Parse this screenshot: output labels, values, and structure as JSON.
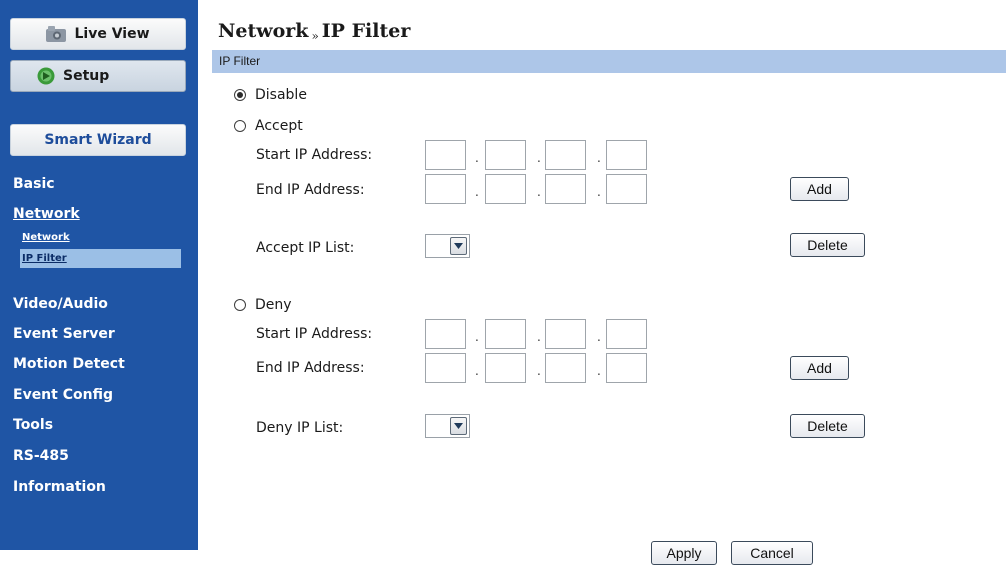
{
  "sidebar": {
    "live_view": "Live View",
    "setup": "Setup",
    "smart_wizard": "Smart Wizard",
    "menu": {
      "basic": "Basic",
      "network": "Network",
      "video_audio": "Video/Audio",
      "event_server": "Event Server",
      "motion_detect": "Motion Detect",
      "event_config": "Event Config",
      "tools": "Tools",
      "rs485": "RS-485",
      "information": "Information"
    },
    "submenu": {
      "network": "Network",
      "ip_filter": "IP Filter"
    }
  },
  "header": {
    "title_section": "Network",
    "title_separator": "»",
    "title_page": "IP Filter",
    "section_bar": "IP Filter"
  },
  "form": {
    "mode_options": [
      {
        "label": "Disable",
        "selected": true
      },
      {
        "label": "Accept",
        "selected": false
      },
      {
        "label": "Deny",
        "selected": false
      }
    ],
    "accept": {
      "start_label": "Start IP Address:",
      "end_label": "End IP Address:",
      "list_label": "Accept IP List:",
      "start_ip": [
        "",
        "",
        "",
        ""
      ],
      "end_ip": [
        "",
        "",
        "",
        ""
      ],
      "list_value": "",
      "add_label": "Add",
      "delete_label": "Delete"
    },
    "deny": {
      "start_label": "Start IP Address:",
      "end_label": "End IP Address:",
      "list_label": "Deny IP List:",
      "start_ip": [
        "",
        "",
        "",
        ""
      ],
      "end_ip": [
        "",
        "",
        "",
        ""
      ],
      "list_value": "",
      "add_label": "Add",
      "delete_label": "Delete"
    },
    "ip_separator": "."
  },
  "footer": {
    "apply": "Apply",
    "cancel": "Cancel"
  },
  "colors": {
    "sidebar_bg": "#1f55a5",
    "section_bar": "#adc6e8",
    "submenu_highlight": "#9bbfe6"
  },
  "icons": {
    "live_view": "video-camera-icon",
    "setup": "gear-icon",
    "select_arrow": "chevron-down-icon"
  }
}
